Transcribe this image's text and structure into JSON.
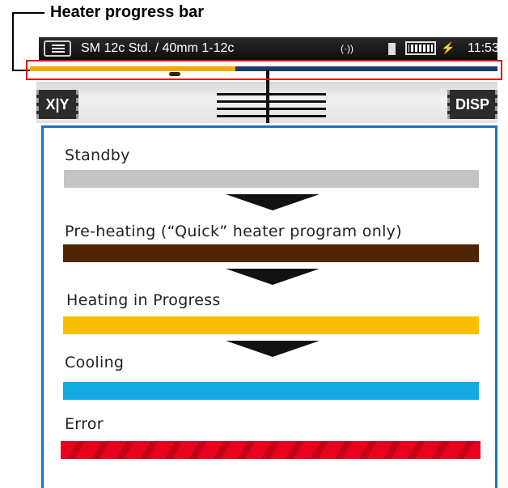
{
  "callout": {
    "title": "Heater progress bar"
  },
  "statusbar": {
    "title": "SM 12c Std. / 40mm 1-12c",
    "wifi_icon": "(·))",
    "clock": "11:53",
    "bolt": "⚡"
  },
  "progress": {
    "fraction": 0.44,
    "fill_color": "#f2a800",
    "track_color": "#233a68"
  },
  "controls": {
    "xy_label": "X|Y",
    "disp_label": "DISP"
  },
  "legend": {
    "border_color": "#1f73c2",
    "items": [
      {
        "label": "Standby",
        "color": "#c4c4c4"
      },
      {
        "label": "Pre-heating (“Quick” heater program only)",
        "color": "#4e2606"
      },
      {
        "label": "Heating in Progress",
        "color": "#fbbf00"
      },
      {
        "label": "Cooling",
        "color": "#14a9e1"
      },
      {
        "label": "Error",
        "color": "#e8001c"
      }
    ]
  }
}
